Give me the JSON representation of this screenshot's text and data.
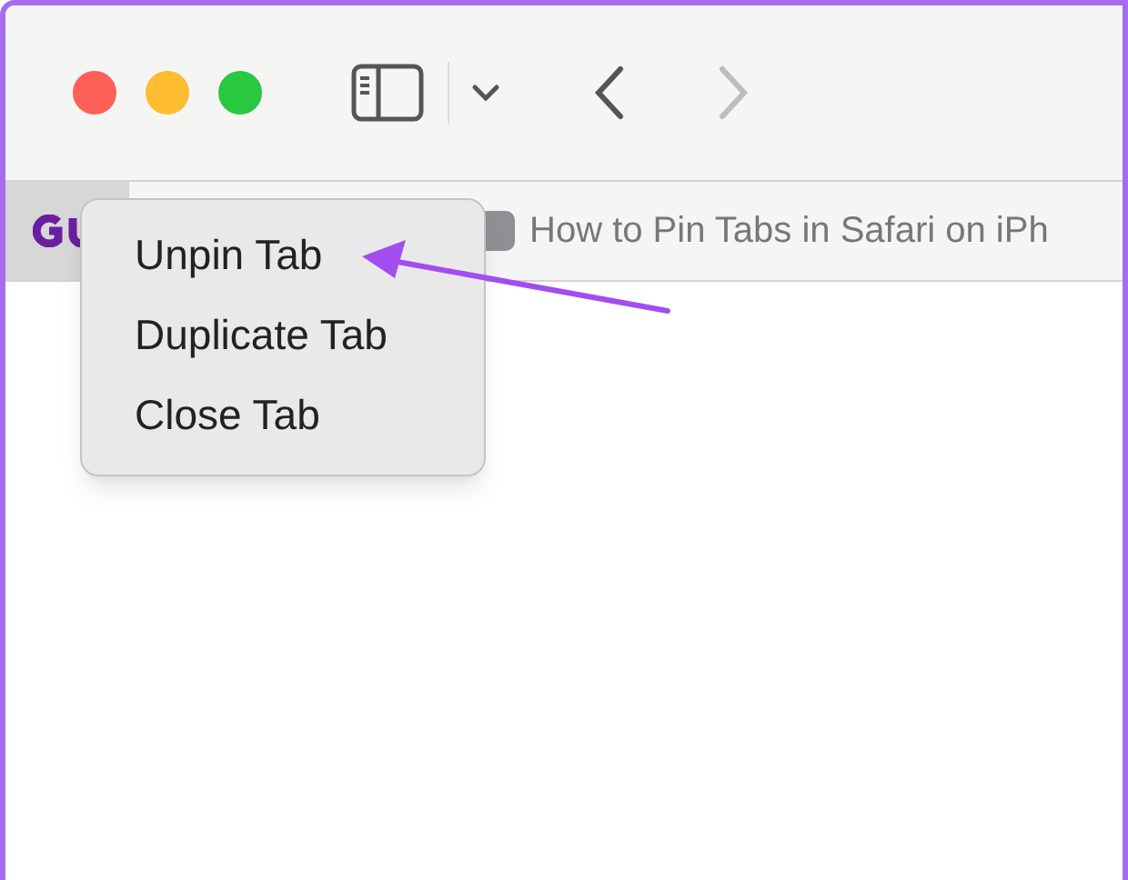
{
  "toolbar": {
    "back_button": {
      "disabled": false
    },
    "forward_button": {
      "disabled": true
    }
  },
  "tabs": [
    {
      "kind": "pinned",
      "selected": false
    },
    {
      "kind": "regular",
      "title": "How to Pin Tabs in Safari on iPh",
      "selected": true
    }
  ],
  "context_menu": {
    "items": [
      {
        "label": "Unpin Tab"
      },
      {
        "label": "Duplicate Tab"
      },
      {
        "label": "Close Tab"
      }
    ]
  }
}
